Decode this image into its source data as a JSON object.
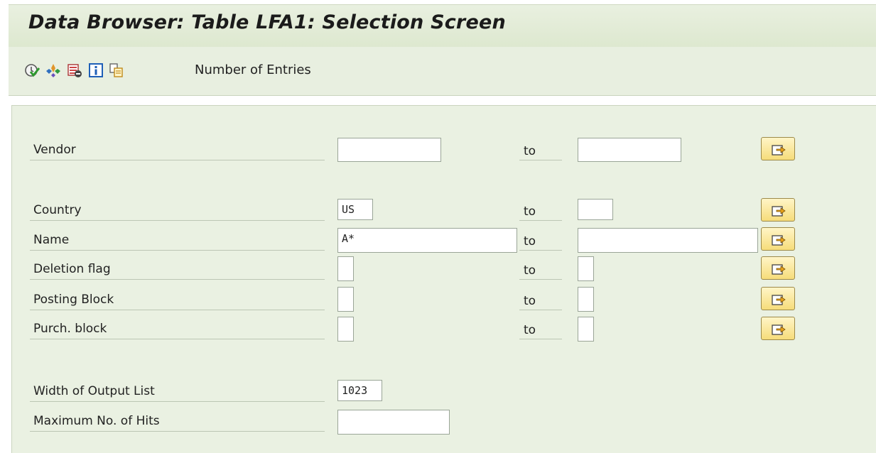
{
  "title": "Data Browser: Table LFA1: Selection Screen",
  "toolbar": {
    "icons": [
      "execute-icon",
      "selection-options-icon",
      "delete-selection-icon",
      "info-icon",
      "copy-icon"
    ],
    "number_of_entries_label": "Number of Entries"
  },
  "form": {
    "to_label": "to",
    "rows": [
      {
        "label": "Vendor",
        "from_value": "",
        "to_value": ""
      },
      {
        "label": "Country",
        "from_value": "US",
        "to_value": ""
      },
      {
        "label": "Name",
        "from_value": "A*",
        "to_value": ""
      },
      {
        "label": "Deletion flag",
        "from_value": "",
        "to_value": ""
      },
      {
        "label": "Posting Block",
        "from_value": "",
        "to_value": ""
      },
      {
        "label": "Purch. block",
        "from_value": "",
        "to_value": ""
      }
    ],
    "width_of_output_list": {
      "label": "Width of Output List",
      "value": "1023"
    },
    "maximum_hits": {
      "label": "Maximum No. of Hits",
      "value": ""
    }
  },
  "colors": {
    "title_background": "#dde8cf",
    "panel_background": "#eaf1e2",
    "button_yellow": "#f6dc7a"
  }
}
